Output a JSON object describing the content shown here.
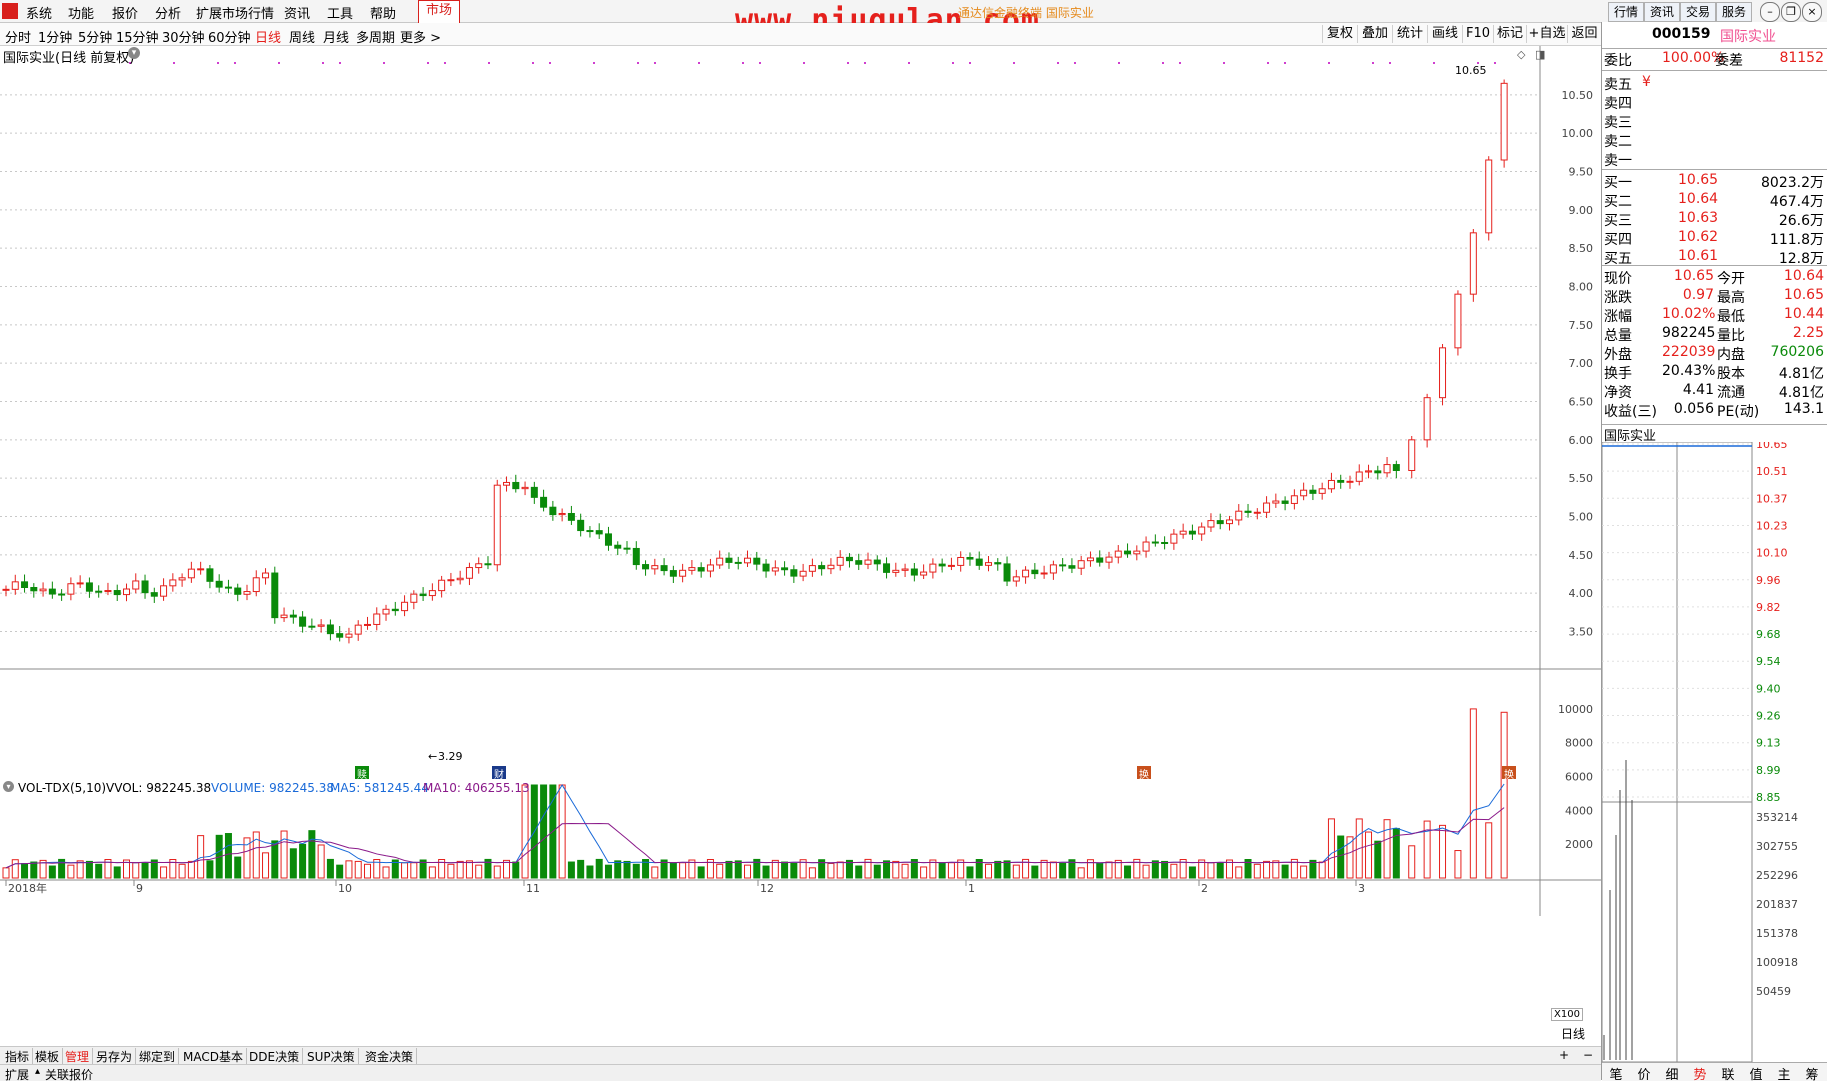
{
  "menu": {
    "items": [
      "系统",
      "功能",
      "报价",
      "分析",
      "扩展市场行情",
      "资讯",
      "工具",
      "帮助"
    ],
    "market_tab": "市场",
    "watermark": "www.niugulan.com",
    "watermark_sub": "通达信金融终端 国际实业",
    "right_tabs": [
      "行情",
      "资讯",
      "交易",
      "服务"
    ]
  },
  "periods": {
    "items": [
      "分时",
      "1分钟",
      "5分钟",
      "15分钟",
      "30分钟",
      "60分钟",
      "日线",
      "周线",
      "月线",
      "多周期",
      "更多 >"
    ],
    "active": "日线",
    "tools": [
      "复权",
      "叠加",
      "统计",
      "画线",
      "F10",
      "标记",
      "+自选",
      "返回"
    ]
  },
  "kline": {
    "title": "国际实业(日线 前复权)",
    "last_label": "10.65",
    "low_label": "3.29",
    "price_ticks": [
      "10.50",
      "10.00",
      "9.50",
      "9.00",
      "8.50",
      "8.00",
      "7.50",
      "7.00",
      "6.50",
      "6.00",
      "5.50",
      "5.00",
      "4.50",
      "4.00",
      "3.50"
    ],
    "markers": [
      {
        "label": "赎",
        "color": "#0a8a0a"
      },
      {
        "label": "财",
        "color": "#1a3a8a"
      },
      {
        "label": "换",
        "color": "#c8501c"
      },
      {
        "label": "换",
        "color": "#c8501c"
      }
    ]
  },
  "volume": {
    "indicator": "VOL-TDX(5,10)",
    "vvol": "VVOL: 982245.38",
    "volume_label": "VOLUME: 982245.38",
    "ma5_label": "MA5: 581245.44",
    "ma10_label": "MA10: 406255.13",
    "ticks": [
      "10000",
      "8000",
      "6000",
      "4000",
      "2000"
    ],
    "unit": "X100"
  },
  "date_axis": {
    "labels": [
      "2018年",
      "9",
      "10",
      "11",
      "12",
      "1",
      "2",
      "3"
    ],
    "period": "日线"
  },
  "bottom_bar": {
    "items": [
      "指标",
      "模板",
      "管理",
      "另存为",
      "绑定到",
      "MACD基本",
      "DDE决策",
      "SUP决策",
      "资金决策"
    ],
    "active": "管理",
    "plus": "+",
    "minus": "−"
  },
  "status_bar": {
    "items": [
      "扩展",
      "关联报价"
    ]
  },
  "quote": {
    "code": "000159",
    "name": "国际实业",
    "weibi_label": "委比",
    "weibi": "100.00%",
    "weicha_label": "委差",
    "weicha": "81152",
    "sells": [
      {
        "label": "卖五",
        "price": "¥",
        "vol": ""
      },
      {
        "label": "卖四",
        "price": "",
        "vol": ""
      },
      {
        "label": "卖三",
        "price": "",
        "vol": ""
      },
      {
        "label": "卖二",
        "price": "",
        "vol": ""
      },
      {
        "label": "卖一",
        "price": "",
        "vol": ""
      }
    ],
    "buys": [
      {
        "label": "买一",
        "price": "10.65",
        "vol": "8023.2万"
      },
      {
        "label": "买二",
        "price": "10.64",
        "vol": "467.4万"
      },
      {
        "label": "买三",
        "price": "10.63",
        "vol": "26.6万"
      },
      {
        "label": "买四",
        "price": "10.62",
        "vol": "111.8万"
      },
      {
        "label": "买五",
        "price": "10.61",
        "vol": "12.8万"
      }
    ],
    "stats": [
      {
        "l1": "现价",
        "v1": "10.65",
        "c1": "red",
        "l2": "今开",
        "v2": "10.64",
        "c2": "red"
      },
      {
        "l1": "涨跌",
        "v1": "0.97",
        "c1": "red",
        "l2": "最高",
        "v2": "10.65",
        "c2": "red"
      },
      {
        "l1": "涨幅",
        "v1": "10.02%",
        "c1": "red",
        "l2": "最低",
        "v2": "10.44",
        "c2": "red"
      },
      {
        "l1": "总量",
        "v1": "982245",
        "c1": "black",
        "l2": "量比",
        "v2": "2.25",
        "c2": "red"
      },
      {
        "l1": "外盘",
        "v1": "222039",
        "c1": "red",
        "l2": "内盘",
        "v2": "760206",
        "c2": "green"
      },
      {
        "l1": "换手",
        "v1": "20.43%",
        "c1": "black",
        "l2": "股本",
        "v2": "4.81亿",
        "c2": "black"
      },
      {
        "l1": "净资",
        "v1": "4.41",
        "c1": "black",
        "l2": "流通",
        "v2": "4.81亿",
        "c2": "black"
      },
      {
        "l1": "收益(三)",
        "v1": "0.056",
        "c1": "black",
        "l2": "PE(动)",
        "v2": "143.1",
        "c2": "black"
      }
    ],
    "mini_title": "国际实业",
    "mini_price_ticks": [
      "10.65",
      "10.51",
      "10.37",
      "10.23",
      "10.10",
      "9.96",
      "9.82",
      "9.68",
      "9.54",
      "9.40",
      "9.26",
      "9.13",
      "8.99",
      "8.85"
    ],
    "mini_vol_ticks": [
      "353214",
      "302755",
      "252296",
      "201837",
      "151378",
      "100918",
      "50459"
    ],
    "tabs": [
      "笔",
      "价",
      "细",
      "势",
      "联",
      "值",
      "主",
      "筹"
    ],
    "active_tab": "势"
  }
}
